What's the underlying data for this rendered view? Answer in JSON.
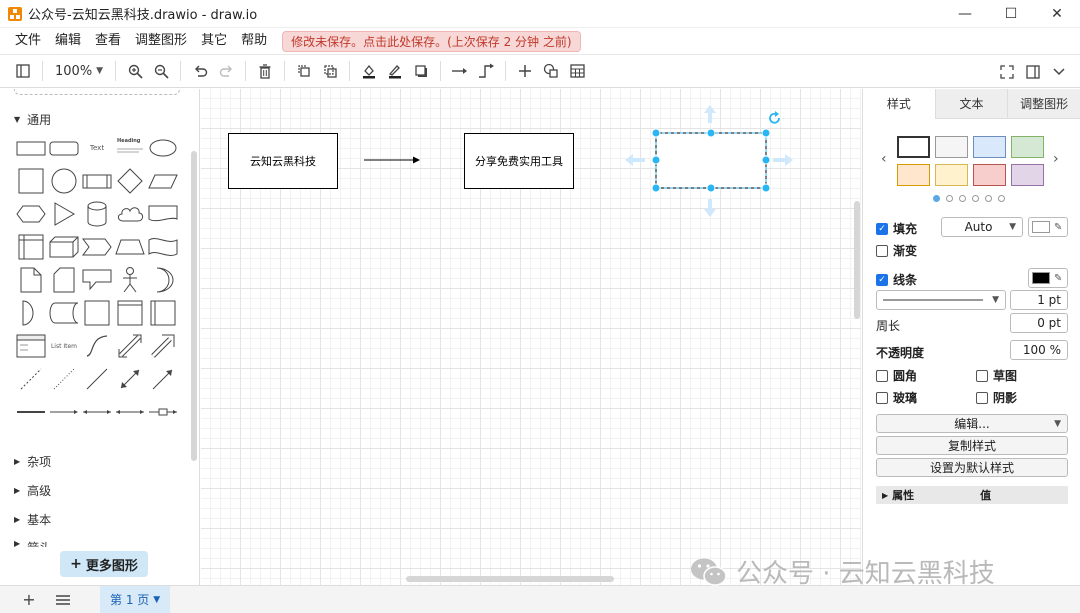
{
  "window": {
    "title": "公众号-云知云黑科技.drawio - draw.io",
    "minimize": "—",
    "maximize": "☐",
    "close": "✕"
  },
  "menu": {
    "items": [
      "文件",
      "编辑",
      "查看",
      "调整图形",
      "其它",
      "帮助"
    ],
    "save_notice": "修改未保存。点击此处保存。(上次保存 2 分钟 之前)"
  },
  "toolbar": {
    "zoom": "100%"
  },
  "sidebar": {
    "sections": [
      "通用",
      "杂项",
      "高级",
      "基本",
      "箭头"
    ],
    "shape_text_label": "Text",
    "shape_heading_label": "Heading",
    "shape_list_label": "List Item",
    "more_shapes": "更多图形"
  },
  "canvas": {
    "node1": "云知云黑科技",
    "node2": "分享免费实用工具"
  },
  "panel": {
    "tabs": [
      "样式",
      "文本",
      "调整图形"
    ],
    "fill_label": "填充",
    "fill_value": "Auto",
    "gradient_label": "渐变",
    "line_label": "线条",
    "line_width": "1 pt",
    "perimeter_label": "周长",
    "perimeter_value": "0 pt",
    "opacity_label": "不透明度",
    "opacity_value": "100 %",
    "rounded_label": "圆角",
    "sketch_label": "草图",
    "glass_label": "玻璃",
    "shadow_label": "阴影",
    "edit_button": "编辑...",
    "copy_style": "复制样式",
    "set_default": "设置为默认样式",
    "props_label": "属性",
    "props_value": "值",
    "swatch_colors": [
      "#ffffff",
      "#f5f5f5",
      "#dae8fc",
      "#d5e8d4",
      "#ffe6cc",
      "#fff2cc",
      "#f8cecc",
      "#e1d5e7"
    ]
  },
  "bottom": {
    "page_tab": "第 1 页"
  },
  "watermark": {
    "text": "公众号 · 云知云黑科技"
  },
  "colors": {
    "accent": "#1a73e8",
    "selection": "#29b6f2",
    "notice_bg": "#f8d7d7",
    "notice_text": "#c0392b"
  }
}
